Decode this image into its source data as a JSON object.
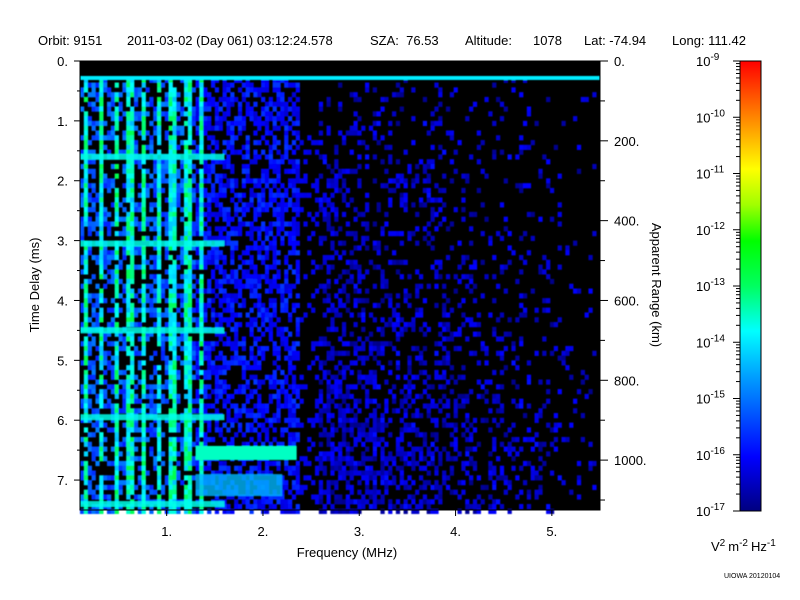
{
  "header": {
    "orbit": "Orbit: 9151",
    "datetime": "2011-03-02 (Day 061) 03:12:24.578",
    "sza": "SZA:  76.53",
    "altitude_label": "Altitude:",
    "altitude_value": "1078",
    "lat": "Lat: -74.94",
    "long": "Long: 111.42"
  },
  "credit": "UIOWA 20120104",
  "colors": {
    "background": "#000000",
    "colormap": [
      "#000080",
      "#0000ff",
      "#0080ff",
      "#00ffff",
      "#00ff80",
      "#00ff00",
      "#80ff00",
      "#ffff00",
      "#ff8000",
      "#ff0000"
    ]
  },
  "chart_data": {
    "type": "heatmap",
    "title": "",
    "xlabel": "Frequency (MHz)",
    "ylabel": "Time Delay (ms)",
    "y2label": "Apparent Range (km)",
    "xlim": [
      0.1,
      5.5
    ],
    "ylim": [
      0,
      7.5
    ],
    "y2lim": [
      0,
      1125
    ],
    "x_ticks": [
      {
        "value": 1,
        "label": "1."
      },
      {
        "value": 2,
        "label": "2."
      },
      {
        "value": 3,
        "label": "3."
      },
      {
        "value": 4,
        "label": "4."
      },
      {
        "value": 5,
        "label": "5."
      }
    ],
    "y_ticks": [
      {
        "value": 0,
        "label": "0."
      },
      {
        "value": 1,
        "label": "1."
      },
      {
        "value": 2,
        "label": "2."
      },
      {
        "value": 3,
        "label": "3."
      },
      {
        "value": 4,
        "label": "4."
      },
      {
        "value": 5,
        "label": "5."
      },
      {
        "value": 6,
        "label": "6."
      },
      {
        "value": 7,
        "label": "7."
      }
    ],
    "y2_ticks": [
      {
        "value": 0,
        "label": "0."
      },
      {
        "value": 200,
        "label": "200."
      },
      {
        "value": 400,
        "label": "400."
      },
      {
        "value": 600,
        "label": "600."
      },
      {
        "value": 800,
        "label": "800."
      },
      {
        "value": 1000,
        "label": "1000."
      }
    ],
    "colorbar": {
      "scale": "log",
      "range": [
        1e-17,
        1e-09
      ],
      "unit": "V^2 m^-2 Hz^-1",
      "unit_base": [
        "V",
        "m",
        "Hz"
      ],
      "unit_exp": [
        "2",
        "-2",
        "-1"
      ],
      "ticks": [
        {
          "base": "10",
          "exp": "-9"
        },
        {
          "base": "10",
          "exp": "-10"
        },
        {
          "base": "10",
          "exp": "-11"
        },
        {
          "base": "10",
          "exp": "-12"
        },
        {
          "base": "10",
          "exp": "-13"
        },
        {
          "base": "10",
          "exp": "-14"
        },
        {
          "base": "10",
          "exp": "-15"
        },
        {
          "base": "10",
          "exp": "-16"
        },
        {
          "base": "10",
          "exp": "-17"
        }
      ]
    },
    "features": [
      {
        "name": "plasma frequency harmonic lines",
        "freq_mhz": [
          0.15,
          0.3,
          0.45,
          0.6,
          0.75,
          0.9,
          1.05,
          1.2,
          1.35
        ],
        "level_log10": -13.5
      },
      {
        "name": "transmitter pulse",
        "delay_ms": 0.25,
        "freq_range_mhz": [
          0.1,
          5.5
        ],
        "level_log10": -14.5
      },
      {
        "name": "ground echo",
        "delay_ms": 6.55,
        "freq_range_mhz": [
          1.3,
          2.35
        ],
        "level_log10": -14.0
      }
    ]
  }
}
